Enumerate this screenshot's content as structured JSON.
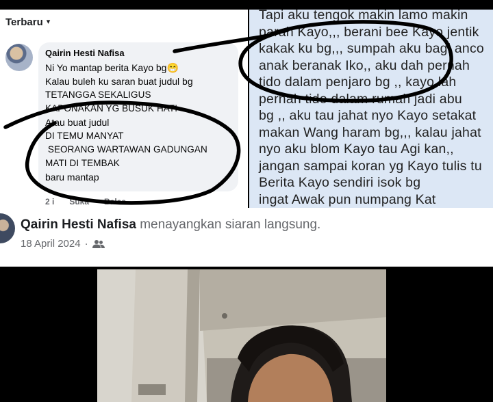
{
  "comments": {
    "sort_label": "Terbaru",
    "author": "Qairin Hesti Nafisa",
    "lines": [
      "Ni Yo mantap berita Kayo bg😁",
      "Kalau buleh ku saran buat judul bg",
      "TETANGGA SEKALIGUS",
      "KAPONAKAN YG BUSUK HATI",
      "Atau buat judul",
      "DI TEMU MANYAT",
      " SEORANG WARTAWAN GADUNGAN",
      "MATI DI TEMBAK",
      "baru mantap"
    ],
    "footer": {
      "time": "2 i",
      "like": "Suka",
      "reply": "Balas"
    }
  },
  "chat_text": {
    "lines": [
      "Tapi aku tengok makin lamo makin",
      "parah Kayo,,, berani bee Kayo jentik",
      "kakak ku bg,,, sumpah aku bagi anco",
      "anak beranak Iko,, aku dah pernah",
      "tido dalam penjaro bg ,, kayo lah",
      "pernah tido dalam rumah jadi abu",
      "bg ,, aku tau jahat nyo Kayo setakat",
      "makan Wang haram bg,,, kalau jahat",
      "nyo aku blom Kayo tau Agi kan,,",
      "jangan sampai koran yg Kayo tulis tu",
      "Berita  Kayo sendiri isok bg",
      "ingat Awak pun numpang Kat"
    ]
  },
  "post": {
    "name": "Qairin Hesti Nafisa",
    "action": " menayangkan siaran langsung.",
    "date": "18 April 2024",
    "separator": "·",
    "audience_icon": "friends-icon"
  },
  "video": {
    "type": "live-video-frame"
  },
  "colors": {
    "bubble": "#f0f2f5",
    "chat_background": "#dce7f5",
    "secondary_text": "#65676b",
    "marker": "#000000"
  }
}
